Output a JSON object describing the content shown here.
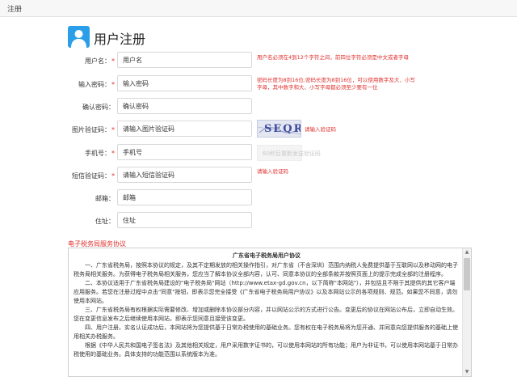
{
  "tab": {
    "label": "注册"
  },
  "header": {
    "title": "用户注册",
    "icon": "user-icon",
    "icon_color": "#2a9ee8"
  },
  "form": {
    "username": {
      "label": "用户名：",
      "placeholder": "用户名",
      "required_mark": "*"
    },
    "password": {
      "label": "输入密码：",
      "placeholder": "输入密码",
      "required_mark": "*"
    },
    "confirm_password": {
      "label": "确认密码：",
      "placeholder": "确认密码"
    },
    "captcha": {
      "label": "图片验证码：",
      "placeholder": "请输入图片验证码",
      "required_mark": "*",
      "image_text": "SEQR"
    },
    "phone": {
      "label": "手机号：",
      "placeholder": "手机号",
      "required_mark": "*"
    },
    "sms_code": {
      "label": "短信验证码：",
      "placeholder": "请输入短信验证码",
      "required_mark": "*"
    },
    "email": {
      "label": "邮箱：",
      "placeholder": "邮箱"
    },
    "address": {
      "label": "住址：",
      "placeholder": "住址"
    }
  },
  "hints": {
    "username": "用户名必须在4到12个字符之间，前四位字符必须是中文或者字母",
    "password": "密码长度为8到16位,密码长度为8到16位，可以使用数字及大、小写字母，其中数字和大、小写字母都必须至少要有一位",
    "captcha": "请输入验证码",
    "sms": "请输入验证码"
  },
  "sms_button": {
    "label": "60秒后重新发送验证码"
  },
  "agreement": {
    "section_title": "电子税务局服务协议",
    "heading": "广东省电子税务局用户协议",
    "paragraphs": [
      "一、广东省税务局，按照本协议的规定，及其不定期发放的相关操作指引，对广东省（不含深圳）范围内纳税人免费提供基于互联网以及移动网的电子税务局相关服务。为获得电子税务局相关服务，您应当了解本协议全部内容，认可、同意本协议的全部条款并按照页面上的提示完成全部的注册程序。",
      "二、本协议适用于广东省税务局建设的\"电子税务局\"网站（http://www.etax-gd.gov.cn，以下简称\"本网站\"），并包括且不限于其提供的其它客户端应用服务。若您在注册过程中点击\"同意\"按钮，即表示您完全接受《广东省电子税务局用户协议》以及本网站公示的各项规则、规范。如果您不同意，请勿使用本网站。",
      "三、广东省税务局有权根据实际需要修改、增加或删除本协议部分内容，并以网站公示的方式进行公告。变更后的协议在网站公布后，立即自动生效。您在变更信息发布之后继续使用本网站，即表示您同意且接受该变更。",
      "四、用户注册。实名认证成功后，本网站将为您提供基于日常办税使用的基础业务。您有权在电子税务局将为您开通、并同意向您提供服务的基础上使用相关办税服务。",
      "根据《中华人民共和国电子签名法》及其他相关规定，用户采用数字证书的，可以使用本网站的所有功能；用户为非证书，可以使用本网站基于日常办税使用的基础业务。具体支持的功能范围以系统版本为准。"
    ]
  },
  "colors": {
    "accent": "#2a9ee8",
    "required": "#e0302d",
    "border": "#d8d8d8"
  }
}
